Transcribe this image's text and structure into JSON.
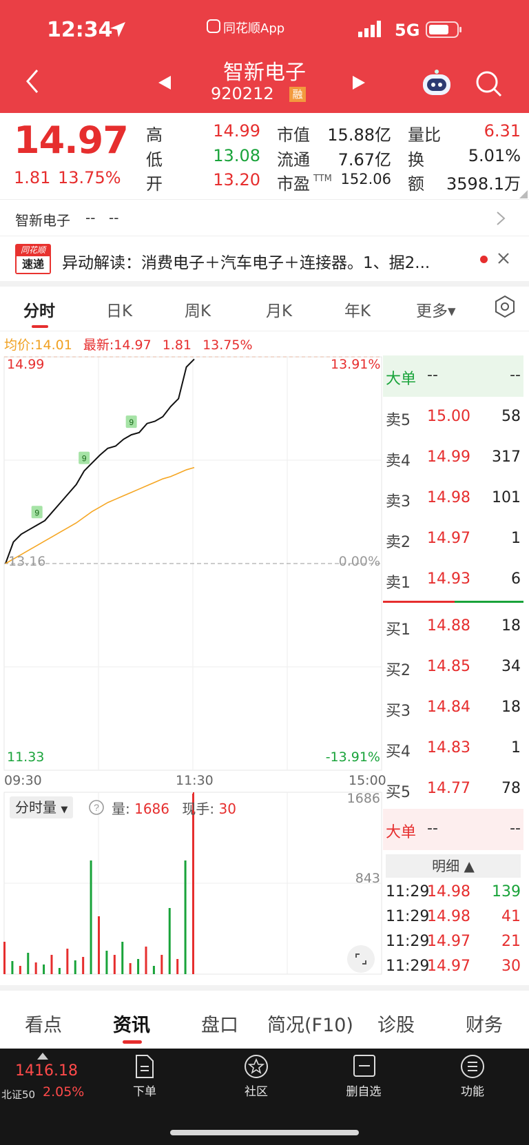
{
  "status_bar": {
    "time": "12:34",
    "carrier_app": "同花顺App",
    "network": "5G"
  },
  "header": {
    "stock_name": "智新电子",
    "stock_code": "920212",
    "margin_badge": "融"
  },
  "quote": {
    "price": "14.97",
    "change": "1.81",
    "change_pct": "13.75%",
    "high_label": "高",
    "high": "14.99",
    "low_label": "低",
    "low": "13.08",
    "open_label": "开",
    "open": "13.20",
    "mcap_label": "市值",
    "mcap": "15.88亿",
    "float_label": "流通",
    "float": "7.67亿",
    "pe_label": "市盈",
    "pe_sup": "TTM",
    "pe": "152.06",
    "vr_label": "量比",
    "vr": "6.31",
    "turn_label": "换",
    "turn": "5.01%",
    "amt_label": "额",
    "amt": "3598.1万"
  },
  "related": {
    "name": "智新电子",
    "v1": "--",
    "v2": "--"
  },
  "news": {
    "logo_top": "同花顺",
    "logo_bottom": "速递",
    "text": "异动解读：消费电子＋汽车电子＋连接器。1、据2..."
  },
  "chart_tabs": [
    "分时",
    "日K",
    "周K",
    "月K",
    "年K",
    "更多▾"
  ],
  "info_line": {
    "avg_label": "均价:",
    "avg": "14.01",
    "latest_label": "最新:",
    "latest": "14.97",
    "chg": "1.81",
    "pct": "13.75%"
  },
  "chart_labels": {
    "top_price": "14.99",
    "top_pct": "13.91%",
    "mid_price": "13.16",
    "mid_pct": "0.00%",
    "bottom_price": "11.33",
    "bottom_pct": "-13.91%",
    "t_start": "09:30",
    "t_mid": "11:30",
    "t_end": "15:00",
    "vol_top": "1686",
    "vol_mid": "843",
    "signal": "9"
  },
  "volume_controls": {
    "selector": "分时量",
    "vol_label": "量:",
    "vol": "1686",
    "hand_label": "现手:",
    "hand": "30"
  },
  "chart_data": {
    "type": "line",
    "x": [
      "09:30",
      "09:35",
      "09:40",
      "09:45",
      "09:50",
      "09:55",
      "10:00",
      "10:05",
      "10:10",
      "10:15",
      "10:20",
      "10:25",
      "10:30",
      "10:35",
      "10:40",
      "10:45",
      "10:50",
      "10:55",
      "11:00",
      "11:05",
      "11:10",
      "11:15",
      "11:20",
      "11:25",
      "11:29"
    ],
    "series": [
      {
        "values": [
          13.16,
          13.35,
          13.42,
          13.46,
          13.5,
          13.54,
          13.62,
          13.7,
          13.78,
          13.86,
          13.98,
          14.05,
          14.12,
          14.18,
          14.2,
          14.26,
          14.3,
          14.32,
          14.4,
          14.42,
          14.46,
          14.55,
          14.62,
          14.9,
          14.97
        ],
        "color": "#111111"
      },
      {
        "values": [
          13.16,
          13.2,
          13.24,
          13.28,
          13.32,
          13.36,
          13.4,
          13.44,
          13.48,
          13.52,
          13.57,
          13.62,
          13.66,
          13.7,
          13.73,
          13.76,
          13.79,
          13.82,
          13.85,
          13.88,
          13.91,
          13.93,
          13.96,
          13.99,
          14.01
        ],
        "color": "#f5a623"
      }
    ],
    "ylim": [
      11.33,
      14.99
    ],
    "volume": [
      300,
      120,
      80,
      200,
      110,
      90,
      180,
      60,
      240,
      130,
      160,
      1060,
      540,
      220,
      180,
      300,
      100,
      140,
      260,
      80,
      180,
      620,
      140,
      1060,
      1686
    ]
  },
  "order_book": {
    "big_label": "大单",
    "big_v1": "--",
    "big_v2": "--",
    "sells": [
      {
        "label": "卖5",
        "price": "15.00",
        "vol": "58"
      },
      {
        "label": "卖4",
        "price": "14.99",
        "vol": "317"
      },
      {
        "label": "卖3",
        "price": "14.98",
        "vol": "101"
      },
      {
        "label": "卖2",
        "price": "14.97",
        "vol": "1"
      },
      {
        "label": "卖1",
        "price": "14.93",
        "vol": "6"
      }
    ],
    "buys": [
      {
        "label": "买1",
        "price": "14.88",
        "vol": "18"
      },
      {
        "label": "买2",
        "price": "14.85",
        "vol": "34"
      },
      {
        "label": "买3",
        "price": "14.84",
        "vol": "18"
      },
      {
        "label": "买4",
        "price": "14.83",
        "vol": "1"
      },
      {
        "label": "买5",
        "price": "14.77",
        "vol": "78"
      }
    ],
    "detail_label": "明细 ▲",
    "ticks": [
      {
        "t": "11:29",
        "p": "14.98",
        "v": "139"
      },
      {
        "t": "11:29",
        "p": "14.98",
        "v": "41"
      },
      {
        "t": "11:29",
        "p": "14.97",
        "v": "21"
      },
      {
        "t": "11:29",
        "p": "14.97",
        "v": "30"
      }
    ]
  },
  "bottom_tabs": [
    "看点",
    "资讯",
    "盘口",
    "简况(F10)",
    "诊股",
    "财务"
  ],
  "dock": {
    "index_value": "1416.18",
    "index_name": "北证50",
    "index_pct": "2.05%",
    "items": [
      "下单",
      "社区",
      "删自选",
      "功能"
    ]
  }
}
